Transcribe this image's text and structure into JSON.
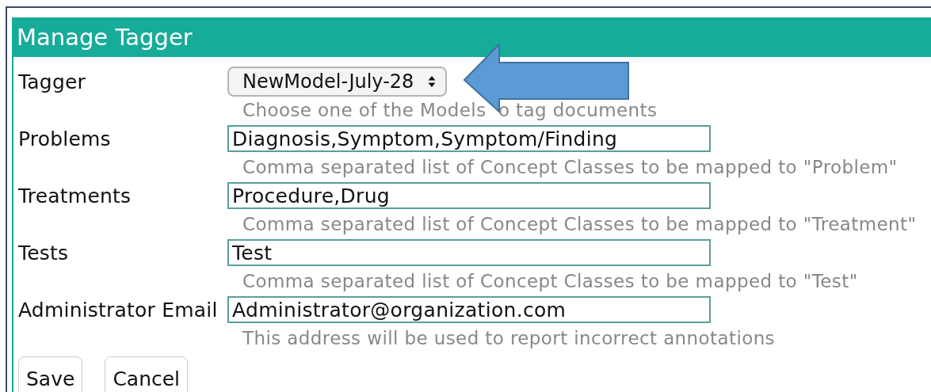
{
  "panel": {
    "title": "Manage Tagger"
  },
  "fields": [
    {
      "kind": "select",
      "label": "Tagger",
      "value": "NewModel-July-28",
      "hint": "Choose one of the Models  o tag documents"
    },
    {
      "kind": "text",
      "label": "Problems",
      "value": "Diagnosis,Symptom,Symptom/Finding",
      "hint": "Comma separated list of Concept Classes to be mapped to \"Problem\""
    },
    {
      "kind": "text",
      "label": "Treatments",
      "value": "Procedure,Drug",
      "hint": "Comma separated list of Concept Classes to be mapped to \"Treatment\""
    },
    {
      "kind": "text",
      "label": "Tests",
      "value": "Test",
      "hint": "Comma separated list of Concept Classes to be mapped to \"Test\""
    },
    {
      "kind": "text",
      "label": "Administrator Email",
      "value": "Administrator@organization.com",
      "hint": "This address will be used to report incorrect annotations"
    }
  ],
  "buttons": [
    "Save",
    "Cancel"
  ]
}
